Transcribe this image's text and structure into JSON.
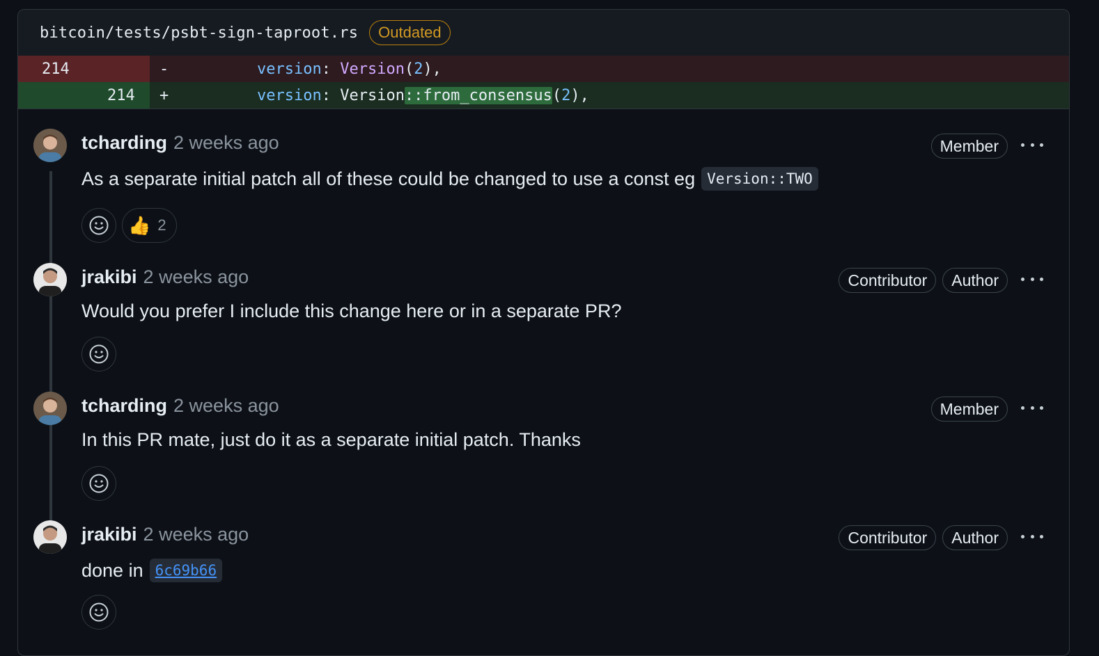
{
  "file": {
    "path": "bitcoin/tests/psbt-sign-taproot.rs",
    "badge": "Outdated"
  },
  "diff": {
    "deleted": {
      "line_number": "214",
      "marker": "-",
      "tokens": [
        "version",
        ": ",
        "Version",
        "(",
        "2",
        "),"
      ]
    },
    "added": {
      "line_number": "214",
      "marker": "+",
      "tokens": [
        "version",
        ": ",
        "Version",
        "::from_consensus",
        "(",
        "2",
        "),"
      ]
    }
  },
  "comments": [
    {
      "author": "tcharding",
      "time": "2 weeks ago",
      "roles": [
        "Member"
      ],
      "text": "As a separate initial patch all of these could be changed to use a const eg",
      "code": "Version::TWO",
      "reactions": [
        {
          "emoji": "👍",
          "count": "2"
        }
      ]
    },
    {
      "author": "jrakibi",
      "time": "2 weeks ago",
      "roles": [
        "Contributor",
        "Author"
      ],
      "text": "Would you prefer I include this change here or in a separate PR?"
    },
    {
      "author": "tcharding",
      "time": "2 weeks ago",
      "roles": [
        "Member"
      ],
      "text": "In this PR mate, just do it as a separate initial patch. Thanks"
    },
    {
      "author": "jrakibi",
      "time": "2 weeks ago",
      "roles": [
        "Contributor",
        "Author"
      ],
      "text": "done in",
      "link": "6c69b66"
    }
  ],
  "icons": {
    "add_reaction": "smiley-icon",
    "more": "kebab-horizontal-icon"
  },
  "colors": {
    "background": "#0d1117",
    "outdated": "#d29922",
    "link": "#4493f8",
    "deletion": "#5a2426",
    "addition": "#1f4a2b"
  }
}
